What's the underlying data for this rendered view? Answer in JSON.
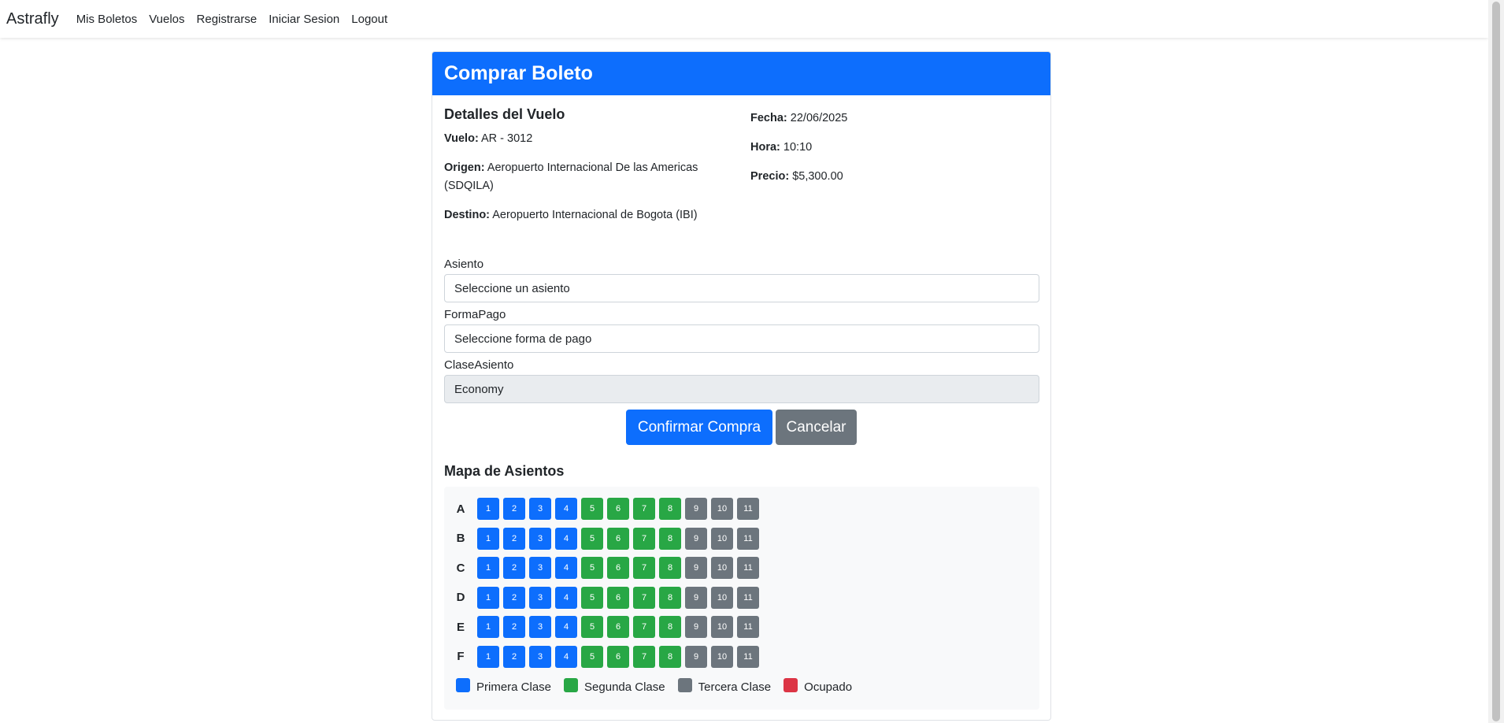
{
  "navbar": {
    "brand": "Astrafly",
    "links": [
      "Mis Boletos",
      "Vuelos",
      "Registrarse",
      "Iniciar Sesion",
      "Logout"
    ]
  },
  "card": {
    "title": "Comprar Boleto",
    "details_title": "Detalles del Vuelo",
    "vuelo_label": "Vuelo:",
    "vuelo_value": "AR - 3012",
    "origen_label": "Origen:",
    "origen_value": "Aeropuerto Internacional De las Americas (SDQILA)",
    "destino_label": "Destino:",
    "destino_value": "Aeropuerto Internacional de Bogota (IBI)",
    "fecha_label": "Fecha:",
    "fecha_value": "22/06/2025",
    "hora_label": "Hora:",
    "hora_value": "10:10",
    "precio_label": "Precio:",
    "precio_value": "$5,300.00"
  },
  "form": {
    "asiento_label": "Asiento",
    "asiento_value": "Seleccione un asiento",
    "formapago_label": "FormaPago",
    "formapago_value": "Seleccione forma de pago",
    "clase_label": "ClaseAsiento",
    "clase_value": "Economy",
    "confirm_label": "Confirmar Compra",
    "cancel_label": "Cancelar"
  },
  "seat_map": {
    "title": "Mapa de Asientos",
    "rows": [
      "A",
      "B",
      "C",
      "D",
      "E",
      "F"
    ],
    "seats": [
      "1",
      "2",
      "3",
      "4",
      "5",
      "6",
      "7",
      "8",
      "9",
      "10",
      "11"
    ],
    "classes": [
      "primera",
      "primera",
      "primera",
      "primera",
      "segunda",
      "segunda",
      "segunda",
      "segunda",
      "tercera",
      "tercera",
      "tercera"
    ]
  },
  "legend": [
    {
      "label": "Primera Clase",
      "color": "#0d6efd"
    },
    {
      "label": "Segunda Clase",
      "color": "#28a745"
    },
    {
      "label": "Tercera Clase",
      "color": "#6c757d"
    },
    {
      "label": "Ocupado",
      "color": "#dc3545"
    }
  ],
  "colors": {
    "primera": "#0d6efd",
    "segunda": "#28a745",
    "tercera": "#6c757d",
    "ocupado": "#dc3545"
  }
}
